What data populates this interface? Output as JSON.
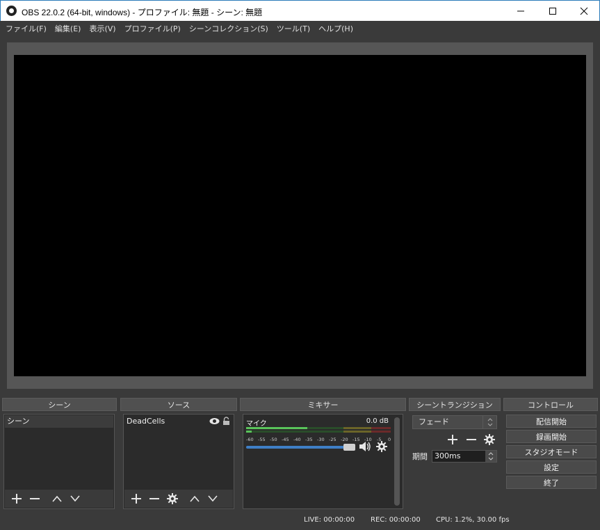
{
  "window": {
    "title": "OBS 22.0.2 (64-bit, windows) - プロファイル: 無題 - シーン: 無題"
  },
  "menu": [
    "ファイル(F)",
    "編集(E)",
    "表示(V)",
    "プロファイル(P)",
    "シーンコレクション(S)",
    "ツール(T)",
    "ヘルプ(H)"
  ],
  "docks": {
    "scenes": {
      "title": "シーン",
      "items": [
        "シーン"
      ]
    },
    "sources": {
      "title": "ソース",
      "items": [
        "DeadCells"
      ]
    },
    "mixer": {
      "title": "ミキサー",
      "channel": "マイク",
      "level": "0.0 dB",
      "ticks": [
        "-60",
        "-55",
        "-50",
        "-45",
        "-40",
        "-35",
        "-30",
        "-25",
        "-20",
        "-15",
        "-10",
        "-5",
        "0"
      ]
    },
    "transitions": {
      "title": "シーントランジション",
      "selected": "フェード",
      "duration_label": "期間",
      "duration_value": "300ms"
    },
    "controls": {
      "title": "コントロール",
      "buttons": [
        "配信開始",
        "録画開始",
        "スタジオモード",
        "設定",
        "終了"
      ]
    }
  },
  "statusbar": {
    "live": "LIVE: 00:00:00",
    "rec": "REC: 00:00:00",
    "cpu": "CPU: 1.2%, 30.00 fps"
  },
  "colors": {
    "background": "#3a3a3a",
    "preview": "#000000",
    "accent": "#3f7fc6",
    "meter_green": "#59c45a"
  }
}
